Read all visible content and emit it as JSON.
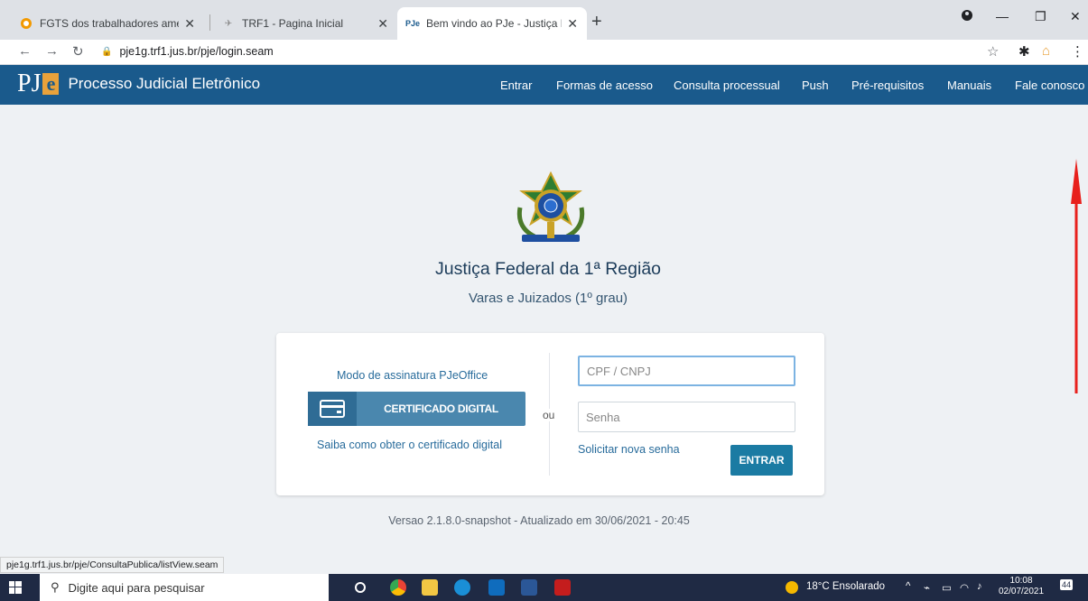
{
  "browser": {
    "tabs": [
      {
        "title": "FGTS dos trabalhadores ameaçad",
        "icon": "generic-site-icon"
      },
      {
        "title": "TRF1 - Pagina Inicial",
        "icon": "trf1-icon"
      },
      {
        "title": "Bem vindo ao PJe - Justiça Federa",
        "icon": "pje-icon",
        "active": true
      }
    ],
    "url": "pje1g.trf1.jus.br/pje/login.seam",
    "status_url": "pje1g.trf1.jus.br/pje/ConsultaPublica/listView.seam"
  },
  "header": {
    "logo_pj": "PJ",
    "logo_e": "e",
    "app_name": "Processo Judicial Eletrônico",
    "nav": [
      "Entrar",
      "Formas de acesso",
      "Consulta processual",
      "Push",
      "Pré-requisitos",
      "Manuais",
      "Fale conosco"
    ],
    "color": "#1a5a8c"
  },
  "main": {
    "org_title": "Justiça Federal da 1ª Região",
    "org_subtitle": "Varas e Juizados (1º grau)",
    "login": {
      "sign_mode_link": "Modo de assinatura PJeOffice",
      "cert_button": "CERTIFICADO DIGITAL",
      "cert_info_link": "Saiba como obter o certificado digital",
      "or": "ou",
      "cpf_placeholder": "CPF / CNPJ",
      "password_placeholder": "Senha",
      "forgot_link": "Solicitar nova senha",
      "submit": "ENTRAR"
    },
    "version": "Versao 2.1.8.0-snapshot - Atualizado em 30/06/2021 - 20:45"
  },
  "taskbar": {
    "search_placeholder": "Digite aqui para pesquisar",
    "weather": "18°C  Ensolarado",
    "time": "10:08",
    "date": "02/07/2021",
    "notifications": "44"
  }
}
